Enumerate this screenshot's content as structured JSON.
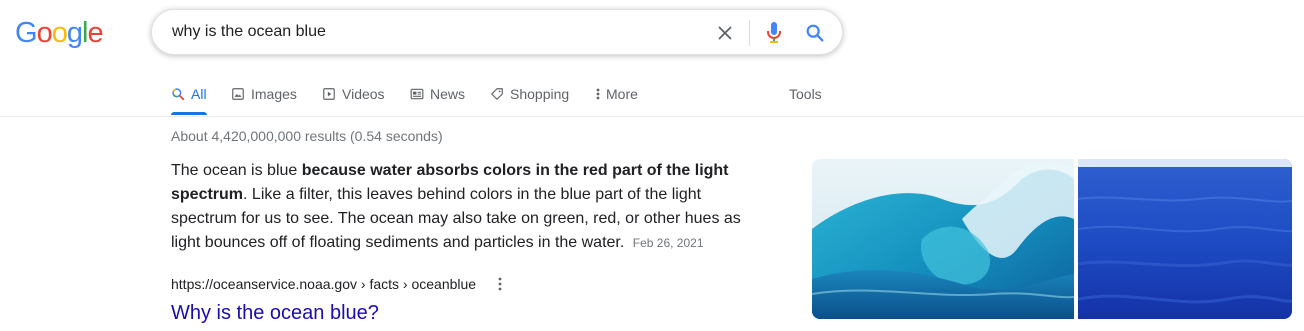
{
  "logo": {
    "letters": [
      "G",
      "o",
      "o",
      "g",
      "l",
      "e"
    ],
    "colors": [
      "#4285F4",
      "#EA4335",
      "#FBBC05",
      "#4285F4",
      "#34A853",
      "#EA4335"
    ]
  },
  "search": {
    "query": "why is the ocean blue",
    "clear_icon": "close-icon",
    "voice_icon": "microphone-icon",
    "search_icon": "search-icon"
  },
  "tabs": [
    {
      "label": "All",
      "icon": "search-icon",
      "active": true
    },
    {
      "label": "Images",
      "icon": "image-icon",
      "active": false
    },
    {
      "label": "Videos",
      "icon": "play-icon",
      "active": false
    },
    {
      "label": "News",
      "icon": "newspaper-icon",
      "active": false
    },
    {
      "label": "Shopping",
      "icon": "tag-icon",
      "active": false
    },
    {
      "label": "More",
      "icon": "more-vert-icon",
      "active": false
    }
  ],
  "tools_label": "Tools",
  "result_stats": "About 4,420,000,000 results (0.54 seconds)",
  "featured_snippet": {
    "text_before": "The ocean is blue ",
    "bold": "because water absorbs colors in the red part of the light spectrum",
    "text_after": ". Like a filter, this leaves behind colors in the blue part of the light spectrum for us to see. The ocean may also take on green, red, or other hues as light bounces off of floating sediments and particles in the water.",
    "date": "Feb 26, 2021"
  },
  "source": {
    "breadcrumb": "https://oceanservice.noaa.gov › facts › oceanblue",
    "title": "Why is the ocean blue?"
  },
  "colors": {
    "accent": "#1a73e8",
    "link": "#1a0dab",
    "muted": "#70757a",
    "text": "#202124"
  }
}
